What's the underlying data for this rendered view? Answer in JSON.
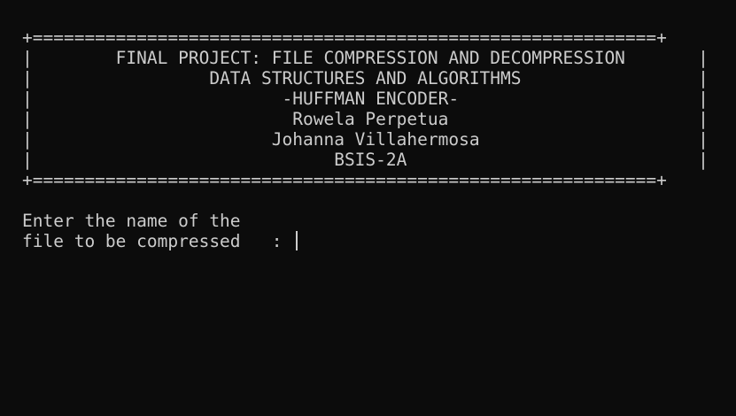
{
  "banner": {
    "top_border": "+============================================================+",
    "title": "|        FINAL PROJECT: FILE COMPRESSION AND DECOMPRESSION       |",
    "course": "|                 DATA STRUCTURES AND ALGORITHMS                 |",
    "subtitle": "|                        -HUFFMAN ENCODER-                       |",
    "author1": "|                         Rowela Perpetua                        |",
    "author2": "|                       Johanna Villahermosa                     |",
    "section": "|                             BSIS-2A                            |",
    "bottom_border": "+============================================================+"
  },
  "prompt": {
    "line1": "Enter the name of the",
    "line2": "file to be compressed   : "
  }
}
